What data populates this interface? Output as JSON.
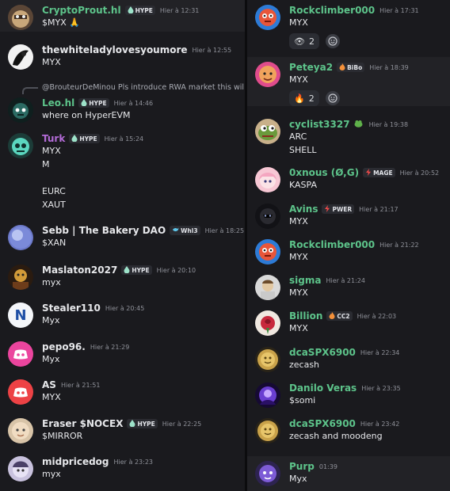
{
  "colors": {
    "background": "#1a1a1e",
    "name_green": "#5dc38a",
    "name_purple": "#b36bd7",
    "name_white": "#e6e7ea",
    "timestamp": "#8f9199"
  },
  "left_messages": [
    {
      "name": "CryptoProut.hl",
      "tag": "HYPE",
      "tag_icon": "drop-icon",
      "time": "Hier à 12:31",
      "lines": [
        "$MYX 🙏"
      ],
      "avatar": "mask-avatar"
    },
    {
      "name": "thewhiteladylovesyoumore",
      "time": "Hier à 12:55",
      "lines": [
        "MYX"
      ],
      "avatar": "ink-avatar"
    },
    {
      "reply": "@BrouteurDeMinou Pls introduce RWA market this wil",
      "name": "Leo.hl",
      "tag": "HYPE",
      "tag_icon": "drop-icon",
      "time": "Hier à 14:46",
      "lines": [
        "where on HyperEVM"
      ],
      "avatar": "robot-avatar"
    },
    {
      "name": "Turk",
      "tag": "HYPE",
      "tag_icon": "drop-icon",
      "time": "Hier à 15:24",
      "lines": [
        "MYX",
        "M",
        "",
        "EURC",
        "XAUT"
      ],
      "avatar": "teal-robot-avatar"
    },
    {
      "name": "Sebb | The Bakery DAO",
      "tag": "Whl3",
      "tag_icon": "whale-icon",
      "time": "Hier à 18:25",
      "lines": [
        "$XAN"
      ],
      "avatar": "gradient-avatar"
    },
    {
      "name": "Maslaton2027",
      "tag": "HYPE",
      "tag_icon": "drop-icon",
      "time": "Hier à 20:10",
      "lines": [
        "myx"
      ],
      "avatar": "gold-avatar"
    },
    {
      "name": "Stealer110",
      "time": "Hier à 20:45",
      "lines": [
        "Myx"
      ],
      "avatar": "n-logo-avatar"
    },
    {
      "name": "pepo96.",
      "time": "Hier à 21:29",
      "lines": [
        "Myx"
      ],
      "avatar": "discord-pink-avatar"
    },
    {
      "name": "AS",
      "time": "Hier à 21:51",
      "lines": [
        "MYX"
      ],
      "avatar": "discord-red-avatar"
    },
    {
      "name": "Eraser $NOCEX",
      "tag": "HYPE",
      "tag_icon": "drop-icon",
      "time": "Hier à 22:25",
      "lines": [
        "$MIRROR"
      ],
      "avatar": "face-avatar"
    },
    {
      "name": "midpricedog",
      "time": "Hier à 23:23",
      "lines": [
        "myx"
      ],
      "avatar": "anime-avatar"
    }
  ],
  "right_messages": [
    {
      "name": "Rockclimber000",
      "time": "Hier à 17:31",
      "lines": [
        "MYX"
      ],
      "avatar": "rock-avatar",
      "reaction": {
        "emoji": "👁",
        "count": "2"
      }
    },
    {
      "name": "Peteya2",
      "tag": "BiBo",
      "tag_icon": "fire-icon",
      "time": "Hier à 18:39",
      "lines": [
        "MYX"
      ],
      "avatar": "pink-avatar",
      "reaction": {
        "emoji": "🔥",
        "count": "2"
      }
    },
    {
      "name": "cyclist3327",
      "tag_icon": "pepe-icon",
      "time": "Hier à 19:38",
      "lines": [
        "ARC",
        "SHELL"
      ],
      "avatar": "pepe-avatar"
    },
    {
      "name": "0xnous (Ø,G)",
      "tag": "MAGE",
      "tag_icon": "bolt-icon",
      "time": "Hier à 20:52",
      "lines": [
        "KASPA"
      ],
      "avatar": "anime-girl-avatar"
    },
    {
      "name": "Avins",
      "tag": "PWER",
      "tag_icon": "bolt-icon",
      "time": "Hier à 21:17",
      "lines": [
        "MYX"
      ],
      "avatar": "dark-avatar"
    },
    {
      "name": "Rockclimber000",
      "time": "Hier à 21:22",
      "lines": [
        "MYX"
      ],
      "avatar": "rock-avatar"
    },
    {
      "name": "sigma",
      "time": "Hier à 21:24",
      "lines": [
        "MYX"
      ],
      "avatar": "sigma-avatar"
    },
    {
      "name": "Billion",
      "tag": "CC2",
      "tag_icon": "fire-icon",
      "time": "Hier à 22:03",
      "lines": [
        "MYX"
      ],
      "avatar": "rose-avatar"
    },
    {
      "name": "dcaSPX6900",
      "time": "Hier à 22:34",
      "lines": [
        "zecash"
      ],
      "avatar": "coin-avatar"
    },
    {
      "name": "Danilo Veras",
      "time": "Hier à 23:35",
      "lines": [
        "$somi"
      ],
      "avatar": "purple-avatar"
    },
    {
      "name": "dcaSPX6900",
      "time": "Hier à 23:42",
      "lines": [
        "zecash and moodeng"
      ],
      "avatar": "coin-avatar"
    },
    {
      "name": "Purp",
      "time": "01:39",
      "lines": [
        "Myx"
      ],
      "avatar": "purp-avatar"
    }
  ]
}
